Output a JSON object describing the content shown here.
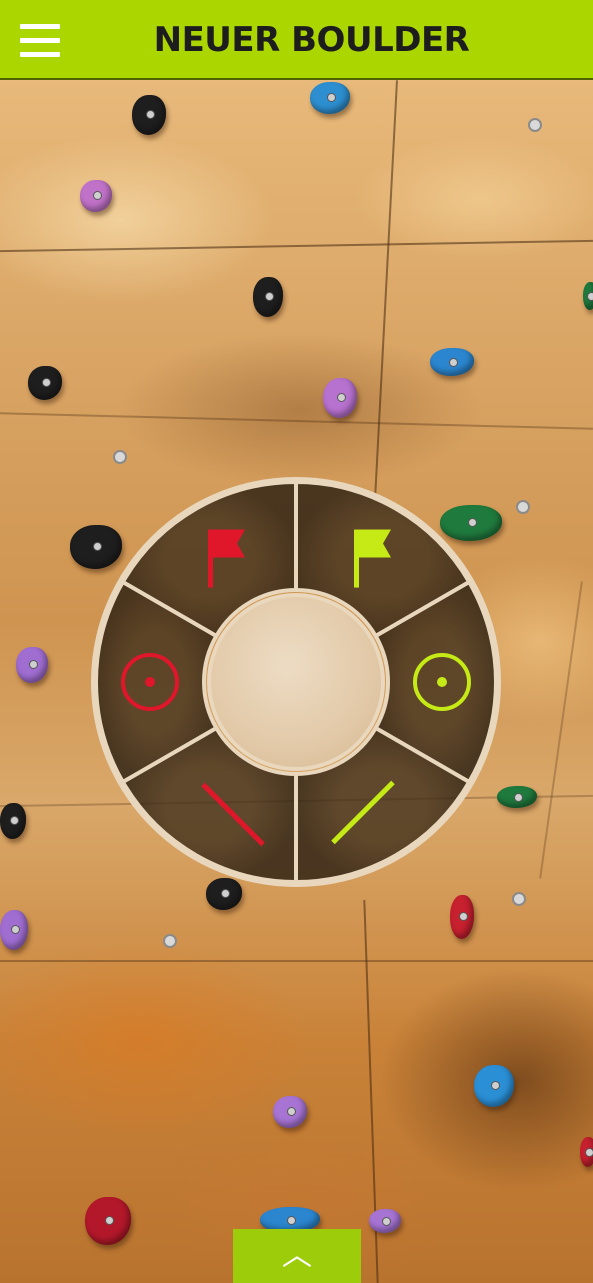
{
  "header": {
    "title": "NEUER BOULDER",
    "menu_icon": "hamburger-menu-icon",
    "background_color": "#acd600"
  },
  "radial_menu": {
    "segments": [
      {
        "id": "start-red",
        "icon": "flag-icon",
        "color": "#e0162b"
      },
      {
        "id": "top-green",
        "icon": "flag-icon",
        "color": "#c5ea15"
      },
      {
        "id": "hold-green",
        "icon": "target-icon",
        "color": "#c5ea15"
      },
      {
        "id": "foot-green",
        "icon": "line-icon",
        "color": "#c5ea15"
      },
      {
        "id": "foot-red",
        "icon": "line-icon",
        "color": "#e0162b"
      },
      {
        "id": "hold-red",
        "icon": "target-icon",
        "color": "#e0162b"
      }
    ]
  },
  "bottom_tab": {
    "icon": "chevron-up-icon",
    "glyph": "︿",
    "color": "#9ccc0a"
  }
}
